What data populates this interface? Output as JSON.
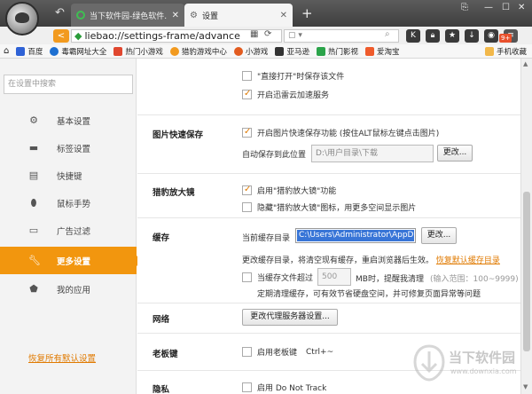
{
  "browser": {
    "tabs": [
      {
        "title": "当下软件园-绿色软件...",
        "active": false
      },
      {
        "title": "设置",
        "active": true
      }
    ],
    "new_tab_label": "+",
    "url": "liebao://settings-frame/advance",
    "badge": "9+"
  },
  "bookmarks": [
    {
      "label": "百度",
      "color": "#2f62d6"
    },
    {
      "label": "毒霸网址大全",
      "color": "#1d6fd1"
    },
    {
      "label": "热门小游戏",
      "color": "#e0472f"
    },
    {
      "label": "猎豹游戏中心",
      "color": "#f29a1f"
    },
    {
      "label": "小游戏",
      "color": "#e25b1f"
    },
    {
      "label": "亚马逊",
      "color": "#333333"
    },
    {
      "label": "热门影视",
      "color": "#2ba44a"
    },
    {
      "label": "爱淘宝",
      "color": "#ef5b2c"
    }
  ],
  "bookmarks_right": "手机收藏",
  "sidebar": {
    "search_placeholder": "在设置中搜索",
    "items": [
      {
        "label": "基本设置",
        "icon": "gear-icon"
      },
      {
        "label": "标签设置",
        "icon": "tab-icon"
      },
      {
        "label": "快捷键",
        "icon": "keyboard-icon"
      },
      {
        "label": "鼠标手势",
        "icon": "mouse-icon"
      },
      {
        "label": "广告过滤",
        "icon": "filter-icon"
      },
      {
        "label": "更多设置",
        "icon": "wrench-icon",
        "active": true
      },
      {
        "label": "我的应用",
        "icon": "puzzle-icon"
      }
    ],
    "restore_label": "恢复所有默认设置"
  },
  "main": {
    "top": {
      "open_save": "\"直接打开\"时保存该文件",
      "xunlei": "开启迅雷云加速服务"
    },
    "image_save": {
      "label": "图片快速保存",
      "enable": "开启图片快速保存功能 (按住ALT鼠标左键点击图片)",
      "auto_label": "自动保存到此位置",
      "path": "D:\\用户目录\\下载",
      "change": "更改..."
    },
    "magnifier": {
      "label": "猎豹放大镜",
      "enable": "启用\"猎豹放大镜\"功能",
      "hide": "隐藏\"猎豹放大镜\"图标，用更多空间显示图片"
    },
    "cache": {
      "label": "缓存",
      "dir_label": "当前缓存目录",
      "dir_value": "C:\\Users\\Administrator\\AppData",
      "change": "更改...",
      "note": "更改缓存目录，将清空现有缓存，重启浏览器后生效。",
      "restore": "恢复默认缓存目录",
      "exceed_label": "当缓存文件超过",
      "exceed_value": "500",
      "exceed_suffix": "MB时，提醒我清理",
      "exceed_range": "(输入范围：100~9999)",
      "exceed_note": "定期清理缓存，可有效节省硬盘空间，并可修复页面异常等问题"
    },
    "network": {
      "label": "网络",
      "proxy": "更改代理服务器设置..."
    },
    "boss_key": {
      "label": "老板键",
      "enable": "启用老板键",
      "hotkey": "Ctrl+~"
    },
    "privacy": {
      "label": "隐私",
      "dnt": "启用 Do Not Track"
    }
  },
  "watermark": {
    "line1": "当下软件园",
    "line2": "www.downxia.com"
  }
}
